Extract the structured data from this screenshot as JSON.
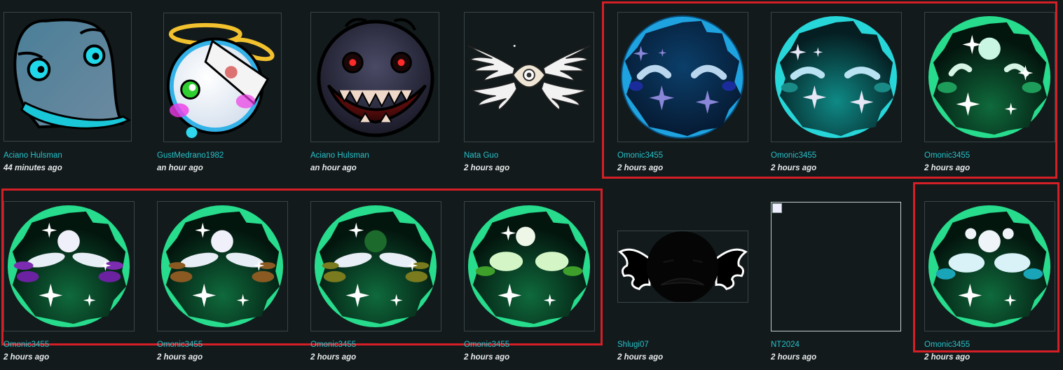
{
  "colors": {
    "background": "#121a1c",
    "author": "#27c2c9",
    "time": "#e8eaea",
    "highlight": "#d51f26"
  },
  "row1": [
    {
      "author": "Aciano Hulsman",
      "time": "44 minutes ago",
      "icon": "blue-blob-face-icon"
    },
    {
      "author": "GustMedrano1982",
      "time": "an hour ago",
      "icon": "angel-ball-face-icon"
    },
    {
      "author": "Aciano Hulsman",
      "time": "an hour ago",
      "icon": "dark-grin-face-icon"
    },
    {
      "author": "Nata Guo",
      "time": "2 hours ago",
      "icon": "winged-eye-icon"
    },
    {
      "author": "Omonic3455",
      "time": "2 hours ago",
      "icon": "blue-orb-face-icon"
    },
    {
      "author": "Omonic3455",
      "time": "2 hours ago",
      "icon": "cyan-orb-face-icon"
    },
    {
      "author": "Omonic3455",
      "time": "2 hours ago",
      "icon": "green-orb-face-icon"
    }
  ],
  "row2": [
    {
      "author": "Omonic3455",
      "time": "2 hours ago",
      "icon": "green-orb-purple-face-icon"
    },
    {
      "author": "Omonic3455",
      "time": "2 hours ago",
      "icon": "green-orb-orange-face-icon"
    },
    {
      "author": "Omonic3455",
      "time": "2 hours ago",
      "icon": "green-orb-yellow-face-icon"
    },
    {
      "author": "Omonic3455",
      "time": "2 hours ago",
      "icon": "green-orb-glow-face-icon"
    },
    {
      "author": "Shlugi07",
      "time": "2 hours ago",
      "icon": "winged-dark-face-icon"
    },
    {
      "author": "NT2024",
      "time": "2 hours ago",
      "icon": "broken-image-icon"
    },
    {
      "author": "Omonic3455",
      "time": "2 hours ago",
      "icon": "green-orb-cyan-face-icon"
    }
  ]
}
